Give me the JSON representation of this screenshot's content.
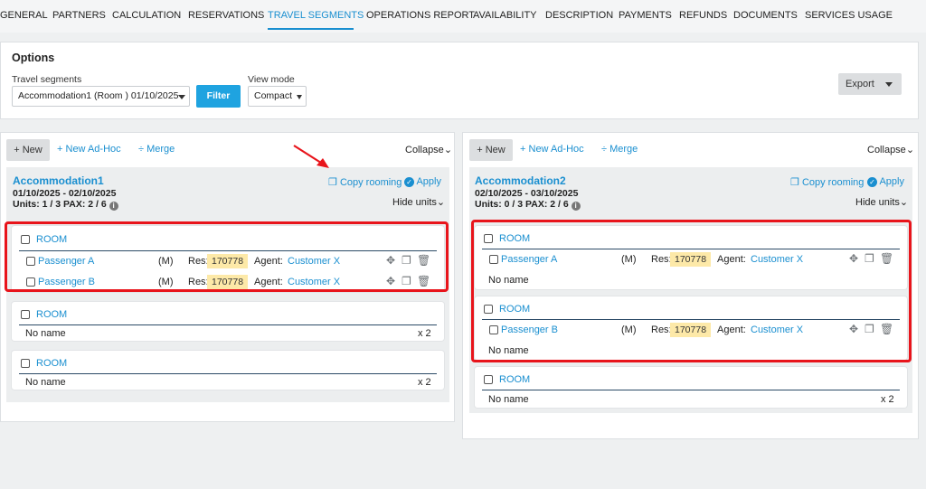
{
  "tabs": [
    "GENERAL",
    "PARTNERS",
    "CALCULATION",
    "RESERVATIONS",
    "TRAVEL SEGMENTS",
    "OPERATIONS REPORT",
    "AVAILABILITY",
    "DESCRIPTION",
    "PAYMENTS",
    "REFUNDS",
    "DOCUMENTS",
    "SERVICES USAGE"
  ],
  "options": {
    "title": "Options",
    "segments_label": "Travel segments",
    "segments_value": "Accommodation1 (Room ) 01/10/2025",
    "filter": "Filter",
    "viewmode_label": "View mode",
    "viewmode_value": "Compact",
    "export": "Export"
  },
  "toolbar": {
    "new": "New",
    "adhoc": "New Ad-Hoc",
    "merge": "Merge",
    "collapse": "Collapse"
  },
  "left": {
    "name": "Accommodation1",
    "dates": "01/10/2025 - 02/10/2025",
    "units": "Units: 1 / 3 PAX: 2 / 6",
    "copy": "Copy rooming",
    "apply": "Apply",
    "hide": "Hide units",
    "room": "ROOM",
    "p1": "Passenger A",
    "p2": "Passenger B",
    "gender": "(M)",
    "res_label": "Res:",
    "res": "170778",
    "agent_label": "Agent:",
    "agent": "Customer X",
    "noname": "No name",
    "x2": "x 2"
  },
  "right": {
    "name": "Accommodation2",
    "dates": "02/10/2025 - 03/10/2025",
    "units": "Units: 0 / 3 PAX: 2 / 6",
    "copy": "Copy rooming",
    "apply": "Apply",
    "hide": "Hide units",
    "room": "ROOM",
    "p1": "Passenger A",
    "p2": "Passenger B",
    "gender": "(M)",
    "res_label": "Res:",
    "res": "170778",
    "agent_label": "Agent:",
    "agent": "Customer X",
    "noname": "No name",
    "x2": "x 2"
  },
  "colors": {
    "accent": "#1a8fd0",
    "highlight": "#e8141b",
    "badge": "#fde9a8"
  },
  "icons": {
    "plus": "plus-icon",
    "merge": "merge-icon",
    "copy": "copy-icon",
    "check": "check-circle-icon",
    "move": "move-icon",
    "trash": "trash-icon",
    "info": "info-icon"
  }
}
